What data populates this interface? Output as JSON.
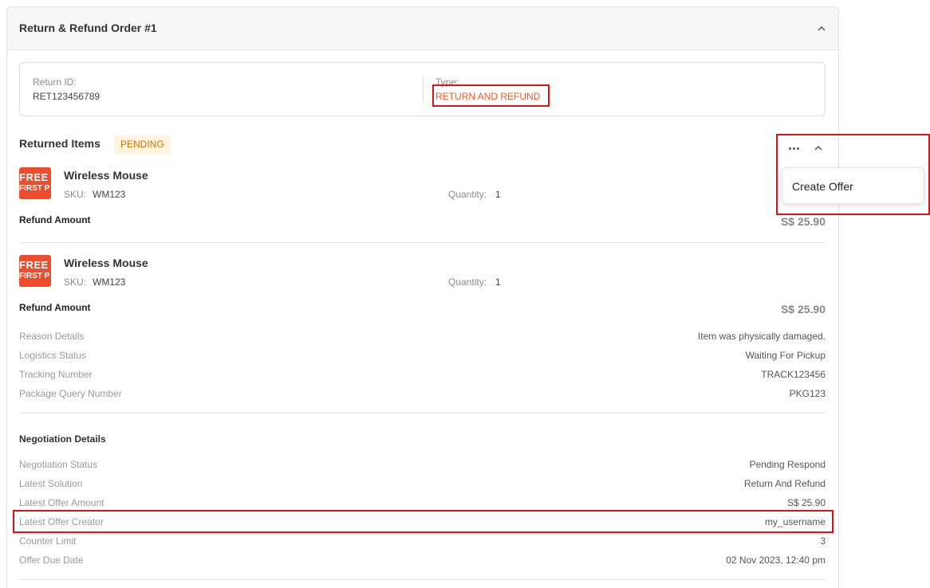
{
  "header": {
    "title": "Return & Refund Order #1"
  },
  "info": {
    "return_id_label": "Return ID:",
    "return_id_value": "RET123456789",
    "type_label": "Type:",
    "type_value": "RETURN AND REFUND"
  },
  "returned_items": {
    "title": "Returned Items",
    "status_badge": "PENDING",
    "items": [
      {
        "thumb_line1": "FREE",
        "thumb_line2": "FIRST P",
        "name": "Wireless Mouse",
        "sku_label": "SKU:",
        "sku": "WM123",
        "qty_label": "Quantity:",
        "qty": "1",
        "refund_label": "Refund Amount",
        "refund_amount": "S$ 25.90"
      },
      {
        "thumb_line1": "FREE",
        "thumb_line2": "FIRST P",
        "name": "Wireless Mouse",
        "sku_label": "SKU:",
        "sku": "WM123",
        "qty_label": "Quantity:",
        "qty": "1",
        "refund_label": "Refund Amount",
        "refund_amount": "S$ 25.90"
      }
    ]
  },
  "details": [
    {
      "label": "Reason Details",
      "value": "Item was physically damaged."
    },
    {
      "label": "Logistics Status",
      "value": "Waiting For Pickup"
    },
    {
      "label": "Tracking Number",
      "value": "TRACK123456"
    },
    {
      "label": "Package Query Number",
      "value": "PKG123"
    }
  ],
  "negotiation": {
    "title": "Negotiation Details",
    "rows": [
      {
        "label": "Negotiation Status",
        "value": "Pending Respond"
      },
      {
        "label": "Latest Solution",
        "value": "Return And Refund"
      },
      {
        "label": "Latest Offer Amount",
        "value": "S$ 25.90"
      },
      {
        "label": "Latest Offer Creator",
        "value": "my_username"
      },
      {
        "label": "Counter Limit",
        "value": "3"
      },
      {
        "label": "Offer Due Date",
        "value": "02 Nov 2023, 12:40 pm"
      }
    ]
  },
  "menu": {
    "create_offer": "Create Offer"
  },
  "icons": {
    "collapse": "chevron-up-icon",
    "more": "more-horizontal-icon",
    "items_collapse": "chevron-up-icon"
  },
  "colors": {
    "accent": "#f05a24",
    "badge_bg": "#fff4de",
    "badge_text": "#c9760b",
    "highlight": "#d9141a",
    "thumb": "#ee4d2d"
  }
}
